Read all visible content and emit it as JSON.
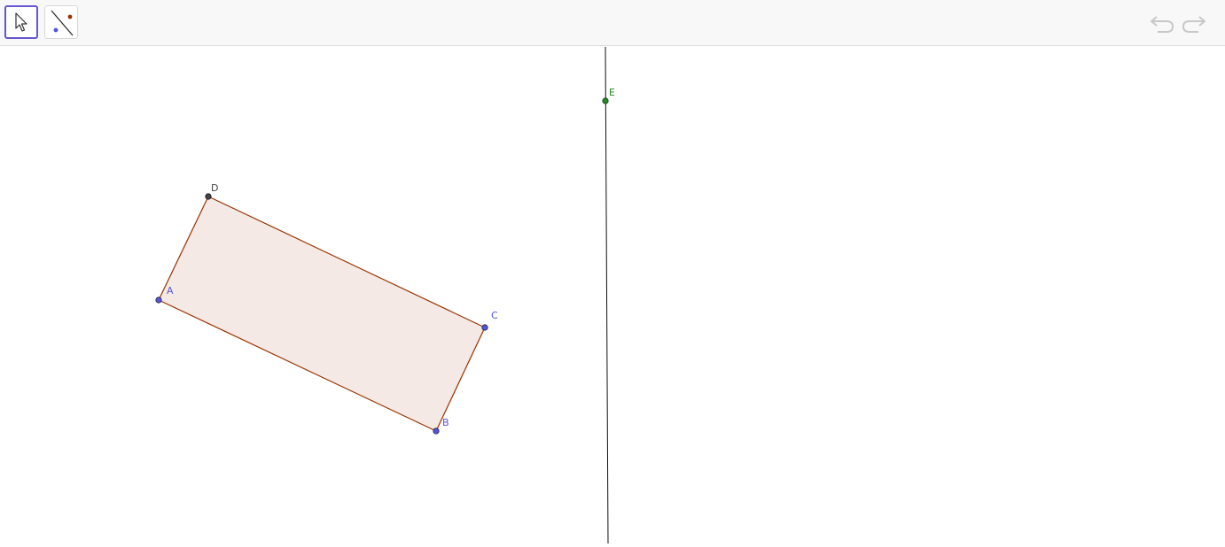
{
  "toolbar": {
    "tools": [
      {
        "name": "Move",
        "icon": "move-arrow-icon",
        "active": true
      },
      {
        "name": "Line",
        "icon": "line-through-two-points-icon",
        "active": false
      }
    ],
    "undo_icon": "undo-icon",
    "redo_icon": "redo-icon"
  },
  "colors": {
    "accent": "#6557d2",
    "free_point": "#5555d8",
    "dependent_point": "#444444",
    "line_point": "#228b22",
    "polygon_stroke": "#993300",
    "polygon_fill": "#f4e9e4",
    "line": "#111111"
  },
  "points": {
    "A": {
      "label": "A"
    },
    "B": {
      "label": "B"
    },
    "C": {
      "label": "C"
    },
    "D": {
      "label": "D"
    },
    "E": {
      "label": "E"
    }
  }
}
